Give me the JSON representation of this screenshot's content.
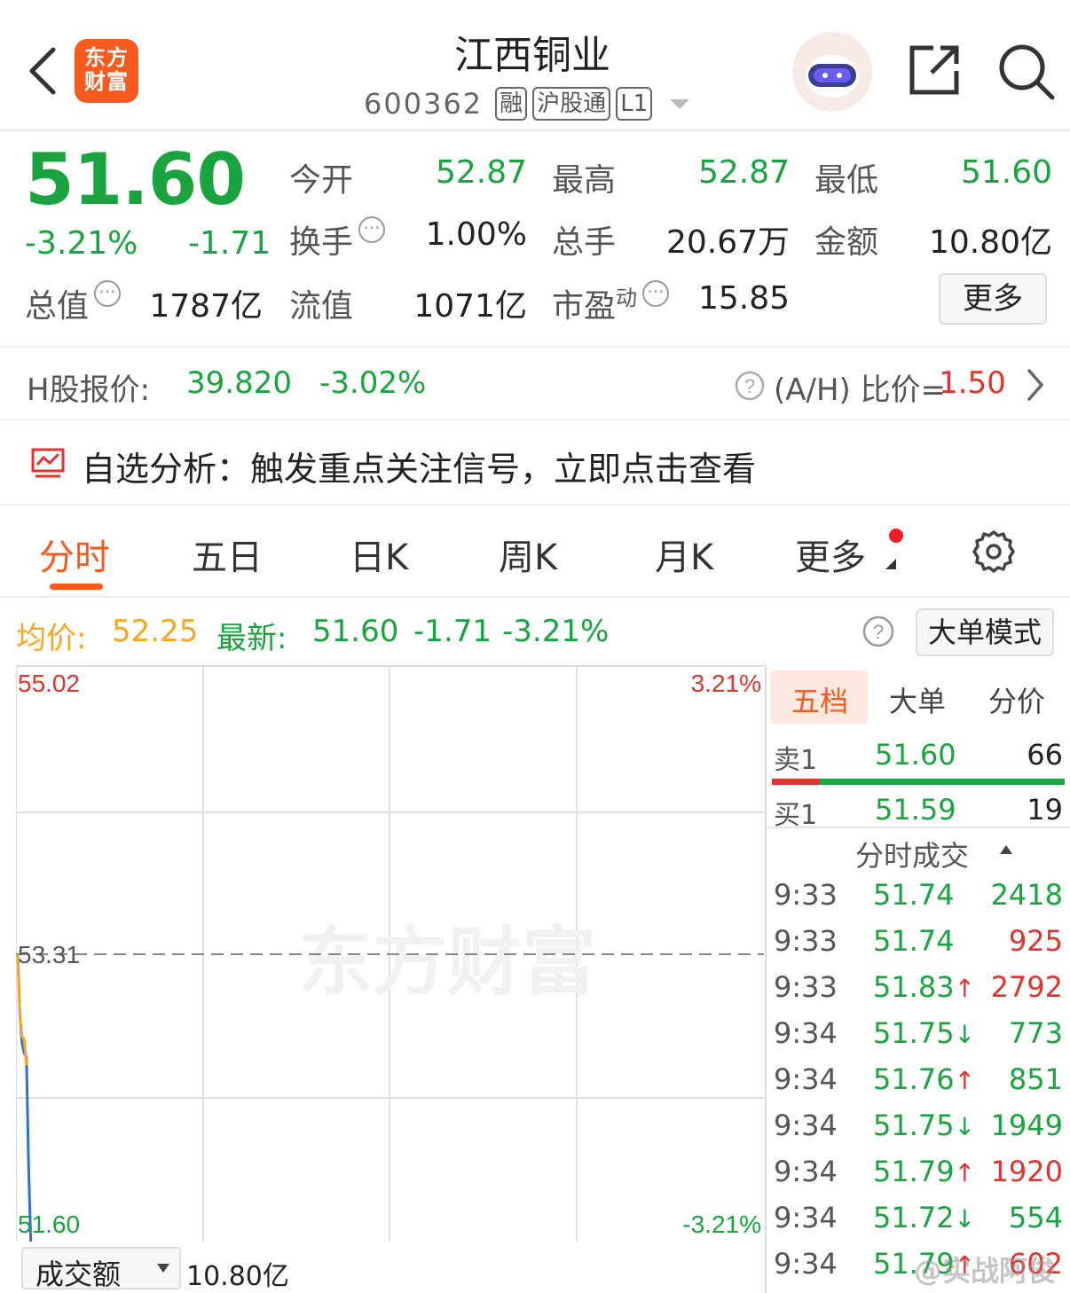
{
  "header": {
    "logo_text": "东方财富",
    "stock_name": "江西铜业",
    "stock_code": "600362",
    "tags": [
      "融",
      "沪股通",
      "L1"
    ]
  },
  "quote": {
    "price": "51.60",
    "change_pct": "-3.21%",
    "change": "-1.71",
    "rows": [
      [
        {
          "label": "今开",
          "value": "52.87",
          "color": "green"
        },
        {
          "label": "最高",
          "value": "52.87",
          "color": "green"
        },
        {
          "label": "最低",
          "value": "51.60",
          "color": "green"
        }
      ],
      [
        {
          "label": "换手",
          "value": "1.00%",
          "color": "dark"
        },
        {
          "label": "总手",
          "value": "20.67万",
          "color": "dark"
        },
        {
          "label": "金额",
          "value": "10.80亿",
          "color": "dark"
        }
      ]
    ],
    "total_value_label": "总值",
    "total_value": "1787亿",
    "float_value_label": "流值",
    "float_value": "1071亿",
    "pe_label": "市盈",
    "pe_super": "动",
    "pe_value": "15.85",
    "more_label": "更多"
  },
  "hshare": {
    "label": "H股报价:",
    "price": "39.820",
    "change_pct": "-3.02%",
    "ratio_label": "(A/H) 比价=",
    "ratio_value": "1.50"
  },
  "alert": {
    "text": "自选分析：触发重点关注信号，立即点击查看"
  },
  "tabs": [
    "分时",
    "五日",
    "日K",
    "周K",
    "月K",
    "更多"
  ],
  "chart_header": {
    "avg_label": "均价:",
    "avg_value": "52.25",
    "latest_label": "最新:",
    "latest_value": "51.60",
    "latest_change": "-1.71",
    "latest_pct": "-3.21%",
    "mode_button": "大单模式"
  },
  "chart_data": {
    "type": "line",
    "y_max_label": "55.02",
    "y_mid_label": "53.31",
    "y_min_label": "51.60",
    "pct_max_label": "3.21%",
    "pct_min_label": "-3.21%",
    "ylim": [
      51.6,
      55.02
    ],
    "reference_price": 53.31,
    "watermark": "东方财富",
    "series": [
      {
        "values": [
          53.31,
          52.95,
          52.78,
          52.72,
          52.7,
          52.05,
          51.6
        ],
        "color": "#2f6fd8"
      },
      {
        "values": [
          53.31,
          52.95,
          52.82,
          52.8,
          52.65
        ],
        "color": "#f5a623"
      }
    ],
    "time_range": [
      "9:30",
      "15:00"
    ]
  },
  "order_panel": {
    "tabs": [
      "五档",
      "大单",
      "分价"
    ],
    "sell1": {
      "label": "卖1",
      "price": "51.60",
      "qty": "66"
    },
    "buy1": {
      "label": "买1",
      "price": "51.59",
      "qty": "19"
    },
    "buy_ratio": 0.16,
    "ticks_title": "分时成交",
    "ticks": [
      {
        "time": "9:33",
        "price": "51.74",
        "arrow": "",
        "qty": "2418",
        "qty_color": "green"
      },
      {
        "time": "9:33",
        "price": "51.74",
        "arrow": "",
        "qty": "925",
        "qty_color": "red"
      },
      {
        "time": "9:33",
        "price": "51.83",
        "arrow": "↑",
        "qty": "2792",
        "qty_color": "red"
      },
      {
        "time": "9:34",
        "price": "51.75",
        "arrow": "↓",
        "qty": "773",
        "qty_color": "green"
      },
      {
        "time": "9:34",
        "price": "51.76",
        "arrow": "↑",
        "qty": "851",
        "qty_color": "green"
      },
      {
        "time": "9:34",
        "price": "51.75",
        "arrow": "↓",
        "qty": "1949",
        "qty_color": "green"
      },
      {
        "time": "9:34",
        "price": "51.79",
        "arrow": "↑",
        "qty": "1920",
        "qty_color": "red"
      },
      {
        "time": "9:34",
        "price": "51.72",
        "arrow": "↓",
        "qty": "554",
        "qty_color": "green"
      },
      {
        "time": "9:34",
        "price": "51.79",
        "arrow": "↑",
        "qty": "602",
        "qty_color": "red"
      }
    ]
  },
  "volume": {
    "selector_label": "成交额",
    "value": "10.80亿"
  },
  "watermark_text": "@实战阿俊",
  "colors": {
    "down": "#1aa33e",
    "up": "#e0332f",
    "accent": "#f75a1e",
    "avg": "#f5a623",
    "price_line": "#2f6fd8"
  },
  "icons": [
    "back-arrow-icon",
    "robot-avatar-icon",
    "share-icon",
    "search-icon",
    "info-circle-icon",
    "question-circle-icon",
    "chevron-right-icon",
    "trend-chart-icon",
    "gear-icon",
    "dropdown-triangle-icon"
  ]
}
